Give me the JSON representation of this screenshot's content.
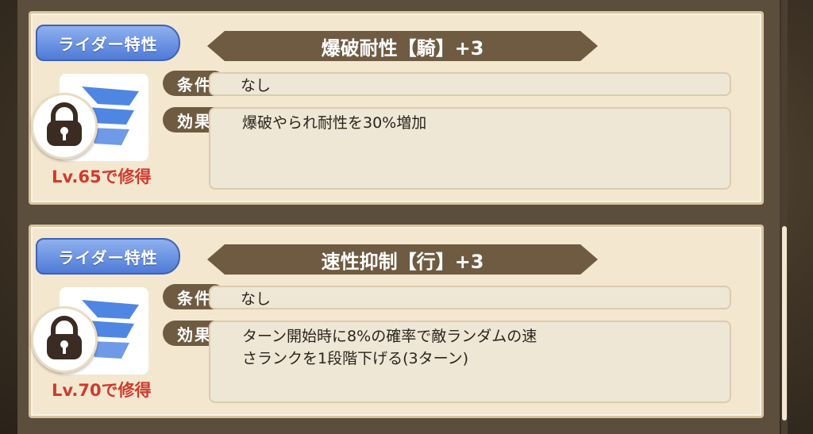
{
  "traits": [
    {
      "badge": "ライダー特性",
      "name": "爆破耐性【騎】+3",
      "condition_label": "条件",
      "condition": "なし",
      "effect_label": "効果",
      "effect": "爆破やられ耐性を30%増加",
      "level": "Lv.65で修得",
      "icon": "wing-skill-icon",
      "locked": true
    },
    {
      "badge": "ライダー特性",
      "name": "速性抑制【行】+3",
      "condition_label": "条件",
      "condition": "なし",
      "effect_label": "効果",
      "effect": "ターン開始時に8%の確率で敵ランダムの速\nさランクを1段階下げる(3ターン)",
      "level": "Lv.70で修得",
      "icon": "wing-skill-icon",
      "locked": true
    }
  ],
  "colors": {
    "badge_blue": "#5a85dc",
    "banner_brown": "#6f5b41",
    "level_red": "#cf3b2d",
    "card_bg": "#f3e7cf"
  }
}
